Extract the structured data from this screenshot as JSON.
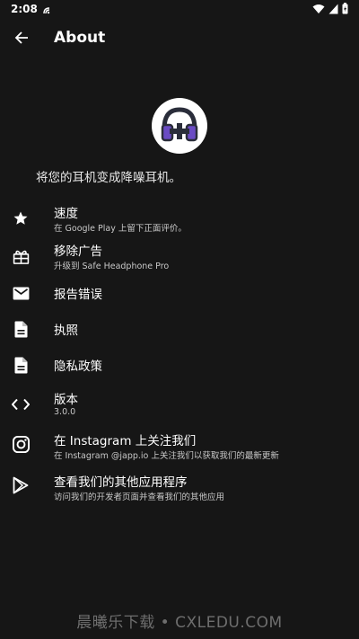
{
  "status_bar": {
    "time": "2:08",
    "icons": [
      "nfc-icon",
      "wifi-icon",
      "signal-icon",
      "battery-icon"
    ]
  },
  "toolbar": {
    "title": "About",
    "back_icon": "arrow-back-icon"
  },
  "app": {
    "icon": "headphones-icon",
    "tagline": "将您的耳机变成降噪耳机。"
  },
  "menu": [
    {
      "icon": "star-icon",
      "title": "速度",
      "subtitle": "在 Google Play 上留下正面评价。"
    },
    {
      "icon": "gift-icon",
      "title": "移除广告",
      "subtitle": "升级到 Safe Headphone Pro"
    },
    {
      "icon": "mail-icon",
      "title": "报告错误",
      "subtitle": ""
    },
    {
      "icon": "document-icon",
      "title": "执照",
      "subtitle": ""
    },
    {
      "icon": "document-icon",
      "title": "隐私政策",
      "subtitle": ""
    },
    {
      "icon": "code-icon",
      "title": "版本",
      "subtitle": "3.0.0"
    },
    {
      "icon": "instagram-icon",
      "title": "在 Instagram 上关注我们",
      "subtitle": "在 Instagram @japp.io 上关注我们以获取我们的最新更新"
    },
    {
      "icon": "play-store-icon",
      "title": "查看我们的其他应用程序",
      "subtitle": "访问我们的开发者页面并查看我们的其他应用"
    }
  ],
  "watermark": "晨曦乐下载 • CXLEDU.COM",
  "colors": {
    "background": "#161616",
    "text": "#ffffff",
    "subtext": "#c8c8c8",
    "accent": "#6a4bc4"
  }
}
